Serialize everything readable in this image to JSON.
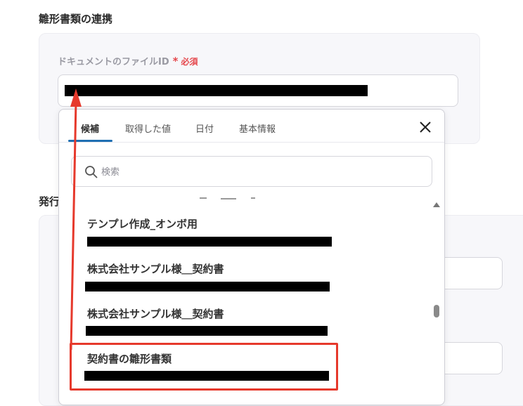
{
  "section": {
    "title": "雛形書類の連携",
    "title_2": "発行"
  },
  "field": {
    "label": "ドキュメントのファイルID",
    "required_mark": "*",
    "required_text": "必須"
  },
  "popup": {
    "tabs": [
      {
        "label": "候補",
        "active": true
      },
      {
        "label": "取得した値",
        "active": false
      },
      {
        "label": "日付",
        "active": false
      },
      {
        "label": "基本情報",
        "active": false
      }
    ],
    "search": {
      "placeholder": "検索",
      "value": ""
    },
    "items": [
      {
        "title": "テンプレ作成_オンボ用"
      },
      {
        "title": "株式会社サンプル様＿契約書"
      },
      {
        "title": "株式会社サンプル様＿契約書"
      },
      {
        "title": "契約書の雛形書類"
      }
    ]
  },
  "colors": {
    "accent": "#1f6fb2",
    "required": "#e5484d",
    "annotation": "#e6392c"
  }
}
